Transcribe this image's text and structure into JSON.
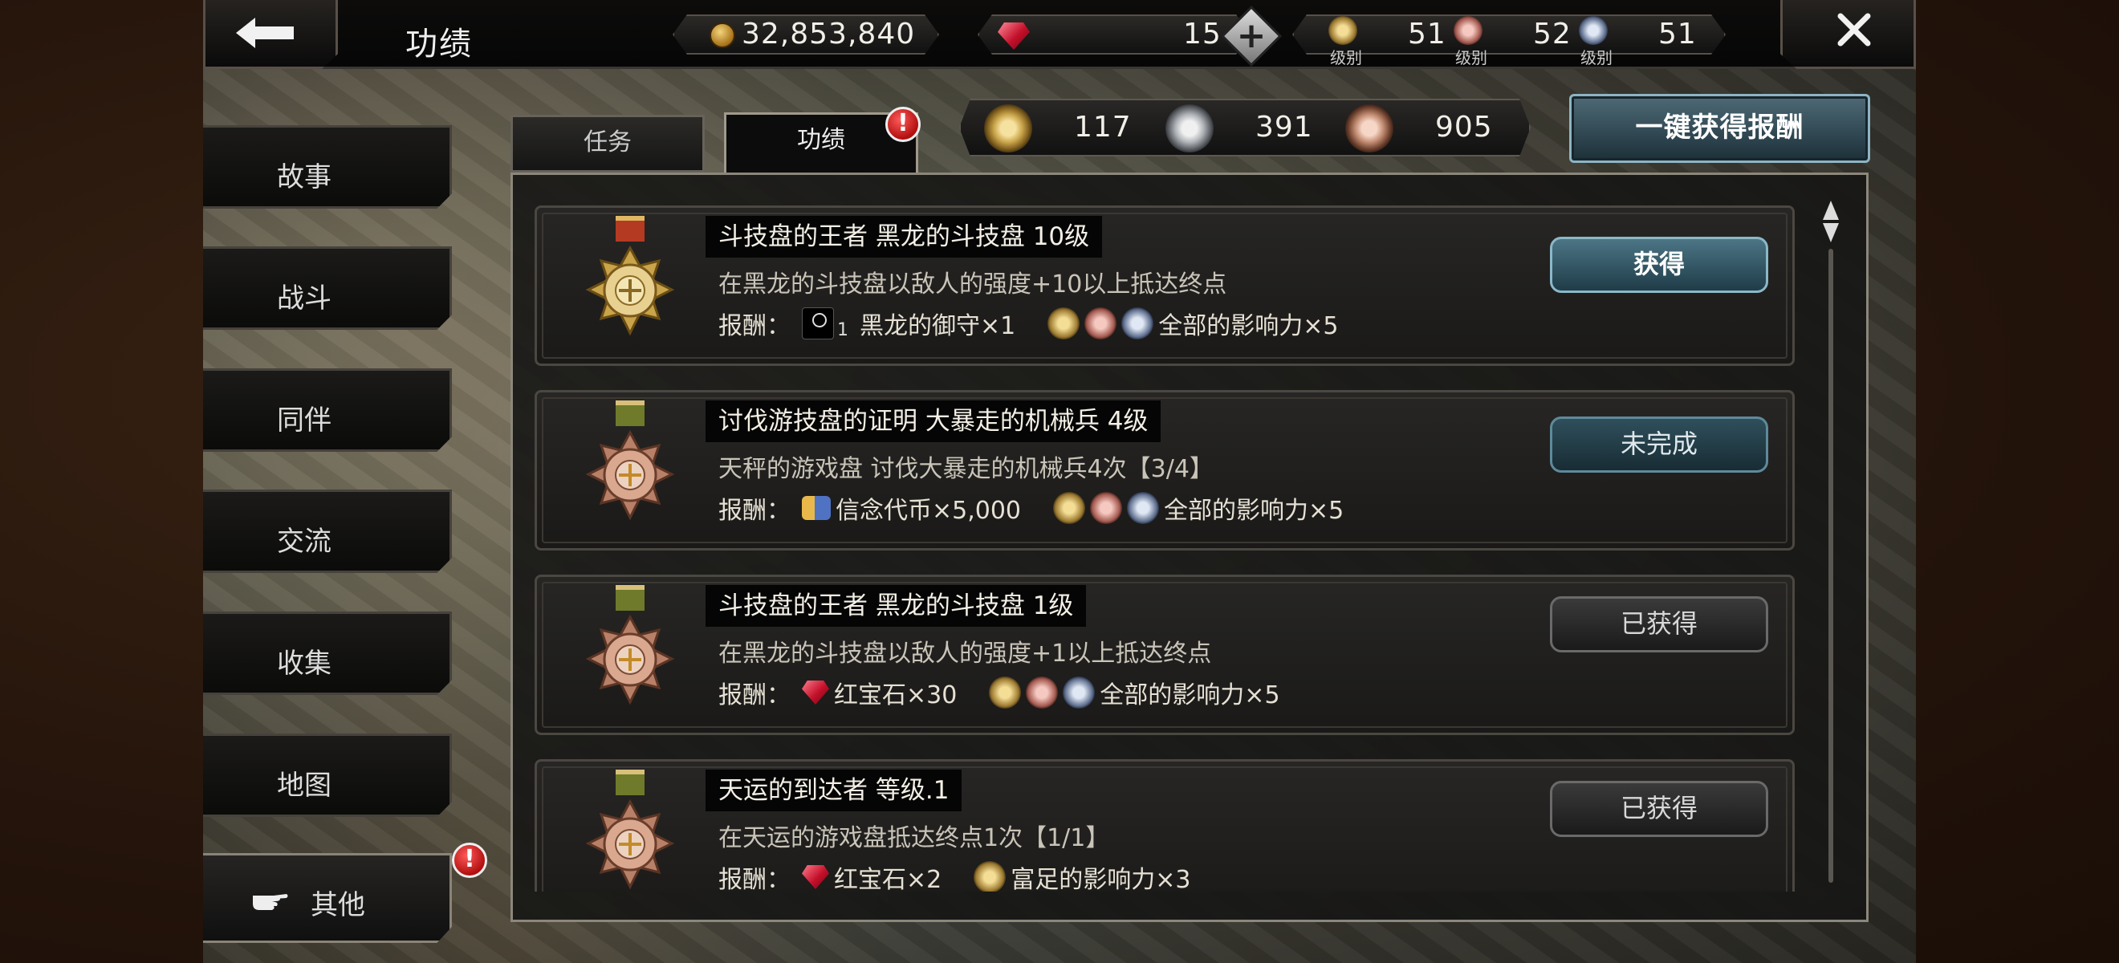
{
  "header": {
    "title": "功绩",
    "gold": "32,853,840",
    "rubies": "15",
    "levels": [
      {
        "label": "级别",
        "value": "51"
      },
      {
        "label": "级别",
        "value": "52"
      },
      {
        "label": "级别",
        "value": "51"
      }
    ]
  },
  "sidebar": {
    "items": [
      {
        "label": "故事"
      },
      {
        "label": "战斗"
      },
      {
        "label": "同伴"
      },
      {
        "label": "交流"
      },
      {
        "label": "收集"
      },
      {
        "label": "地图"
      },
      {
        "label": "其他"
      }
    ],
    "badge": "!"
  },
  "tabs": {
    "task": "任务",
    "merit": "功绩",
    "badge": "!"
  },
  "counters": {
    "gold": "117",
    "silver": "391",
    "bronze": "905"
  },
  "claim_all": "一键获得报酬",
  "reward_label": "报酬：",
  "achievements": [
    {
      "title": "斗技盘的王者  黑龙的斗技盘  10级",
      "desc": "在黑龙的斗技盘以敌人的强度+10以上抵达终点",
      "item_text": "黑龙的御守×1",
      "item_sub": "1",
      "influence": "全部的影响力×5",
      "button": "获得",
      "medal": "gold"
    },
    {
      "title": "讨伐游技盘的证明  大暴走的机械兵  4级",
      "desc": "天秤的游戏盘  讨伐大暴走的机械兵4次【3/4】",
      "item_text": "信念代币×5,000",
      "influence": "全部的影响力×5",
      "button": "未完成",
      "medal": "bronze"
    },
    {
      "title": "斗技盘的王者  黑龙的斗技盘  1级",
      "desc": "在黑龙的斗技盘以敌人的强度+1以上抵达终点",
      "item_text": "红宝石×30",
      "influence": "全部的影响力×5",
      "button": "已获得",
      "medal": "bronze"
    },
    {
      "title": "天运的到达者  等级.1",
      "desc": "在天运的游戏盘抵达终点1次【1/1】",
      "item_text": "红宝石×2",
      "influence": "富足的影响力×3",
      "button": "已获得",
      "medal": "bronze"
    }
  ]
}
